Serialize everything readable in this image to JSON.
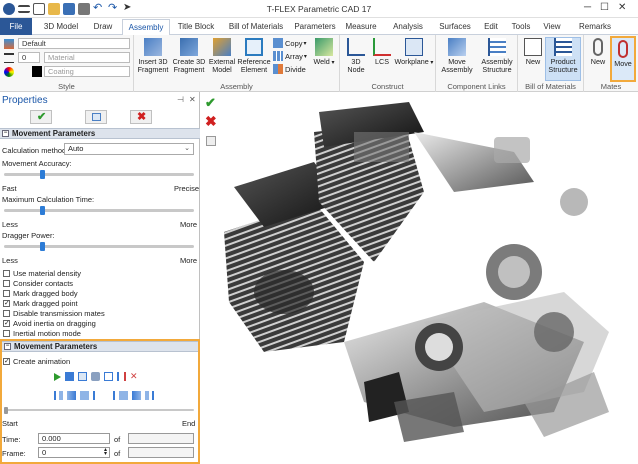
{
  "app": {
    "title": "T-FLEX Parametric CAD 17"
  },
  "tabs": [
    {
      "label": "File"
    },
    {
      "label": "3D Model"
    },
    {
      "label": "Draw"
    },
    {
      "label": "Assembly"
    },
    {
      "label": "Title Block"
    },
    {
      "label": "Bill of Materials"
    },
    {
      "label": "Parameters"
    },
    {
      "label": "Measure"
    },
    {
      "label": "Analysis"
    },
    {
      "label": "Surfaces"
    },
    {
      "label": "Edit"
    },
    {
      "label": "Tools"
    },
    {
      "label": "View"
    },
    {
      "label": "Remarks"
    }
  ],
  "ribbon": {
    "style": {
      "label": "Style",
      "layer": "Default",
      "width": "0",
      "material": "Material",
      "coating": "Coating"
    },
    "assembly": {
      "label": "Assembly",
      "insert": "Insert 3D\nFragment",
      "create": "Create 3D\nFragment",
      "external": "External\nModel",
      "reference": "Reference\nElement",
      "copy": "Copy",
      "array": "Array",
      "divide": "Divide",
      "weld": "Weld"
    },
    "construct": {
      "label": "Construct",
      "node": "3D\nNode",
      "lcs": "LCS",
      "workplane": "Workplane"
    },
    "links": {
      "label": "Component Links",
      "move_assembly": "Move\nAssembly",
      "structure": "Assembly\nStructure"
    },
    "bom": {
      "label": "Bill of Materials",
      "new": "New",
      "product": "Product\nStructure"
    },
    "mates": {
      "label": "Mates",
      "new": "New",
      "move": "Move"
    }
  },
  "panel": {
    "title": "Properties",
    "section1": "Movement Parameters",
    "calc_method_label": "Calculation method:",
    "calc_method_value": "Auto",
    "accuracy_label": "Movement Accuracy:",
    "accuracy_left": "Fast",
    "accuracy_right": "Precise",
    "accuracy_level": 0.2,
    "max_time_label": "Maximum Calculation Time:",
    "max_time_left": "Less",
    "max_time_right": "More",
    "max_time_level": 0.2,
    "dragger_label": "Dragger Power:",
    "dragger_left": "Less",
    "dragger_right": "More",
    "dragger_level": 0.2,
    "options": [
      {
        "label": "Use material density",
        "checked": false
      },
      {
        "label": "Consider contacts",
        "checked": false
      },
      {
        "label": "Mark dragged body",
        "checked": false
      },
      {
        "label": "Mark dragged point",
        "checked": true
      },
      {
        "label": "Disable transmission mates",
        "checked": false
      },
      {
        "label": "Avoid inertia on dragging",
        "checked": true
      },
      {
        "label": "Inertial motion mode",
        "checked": false
      }
    ],
    "section2": "Movement Parameters",
    "create_animation": "Create animation",
    "start_label": "Start",
    "end_label": "End",
    "time_label": "Time:",
    "time_value": "0.000",
    "of_label": "of",
    "frame_label": "Frame:",
    "frame_value": "0"
  }
}
